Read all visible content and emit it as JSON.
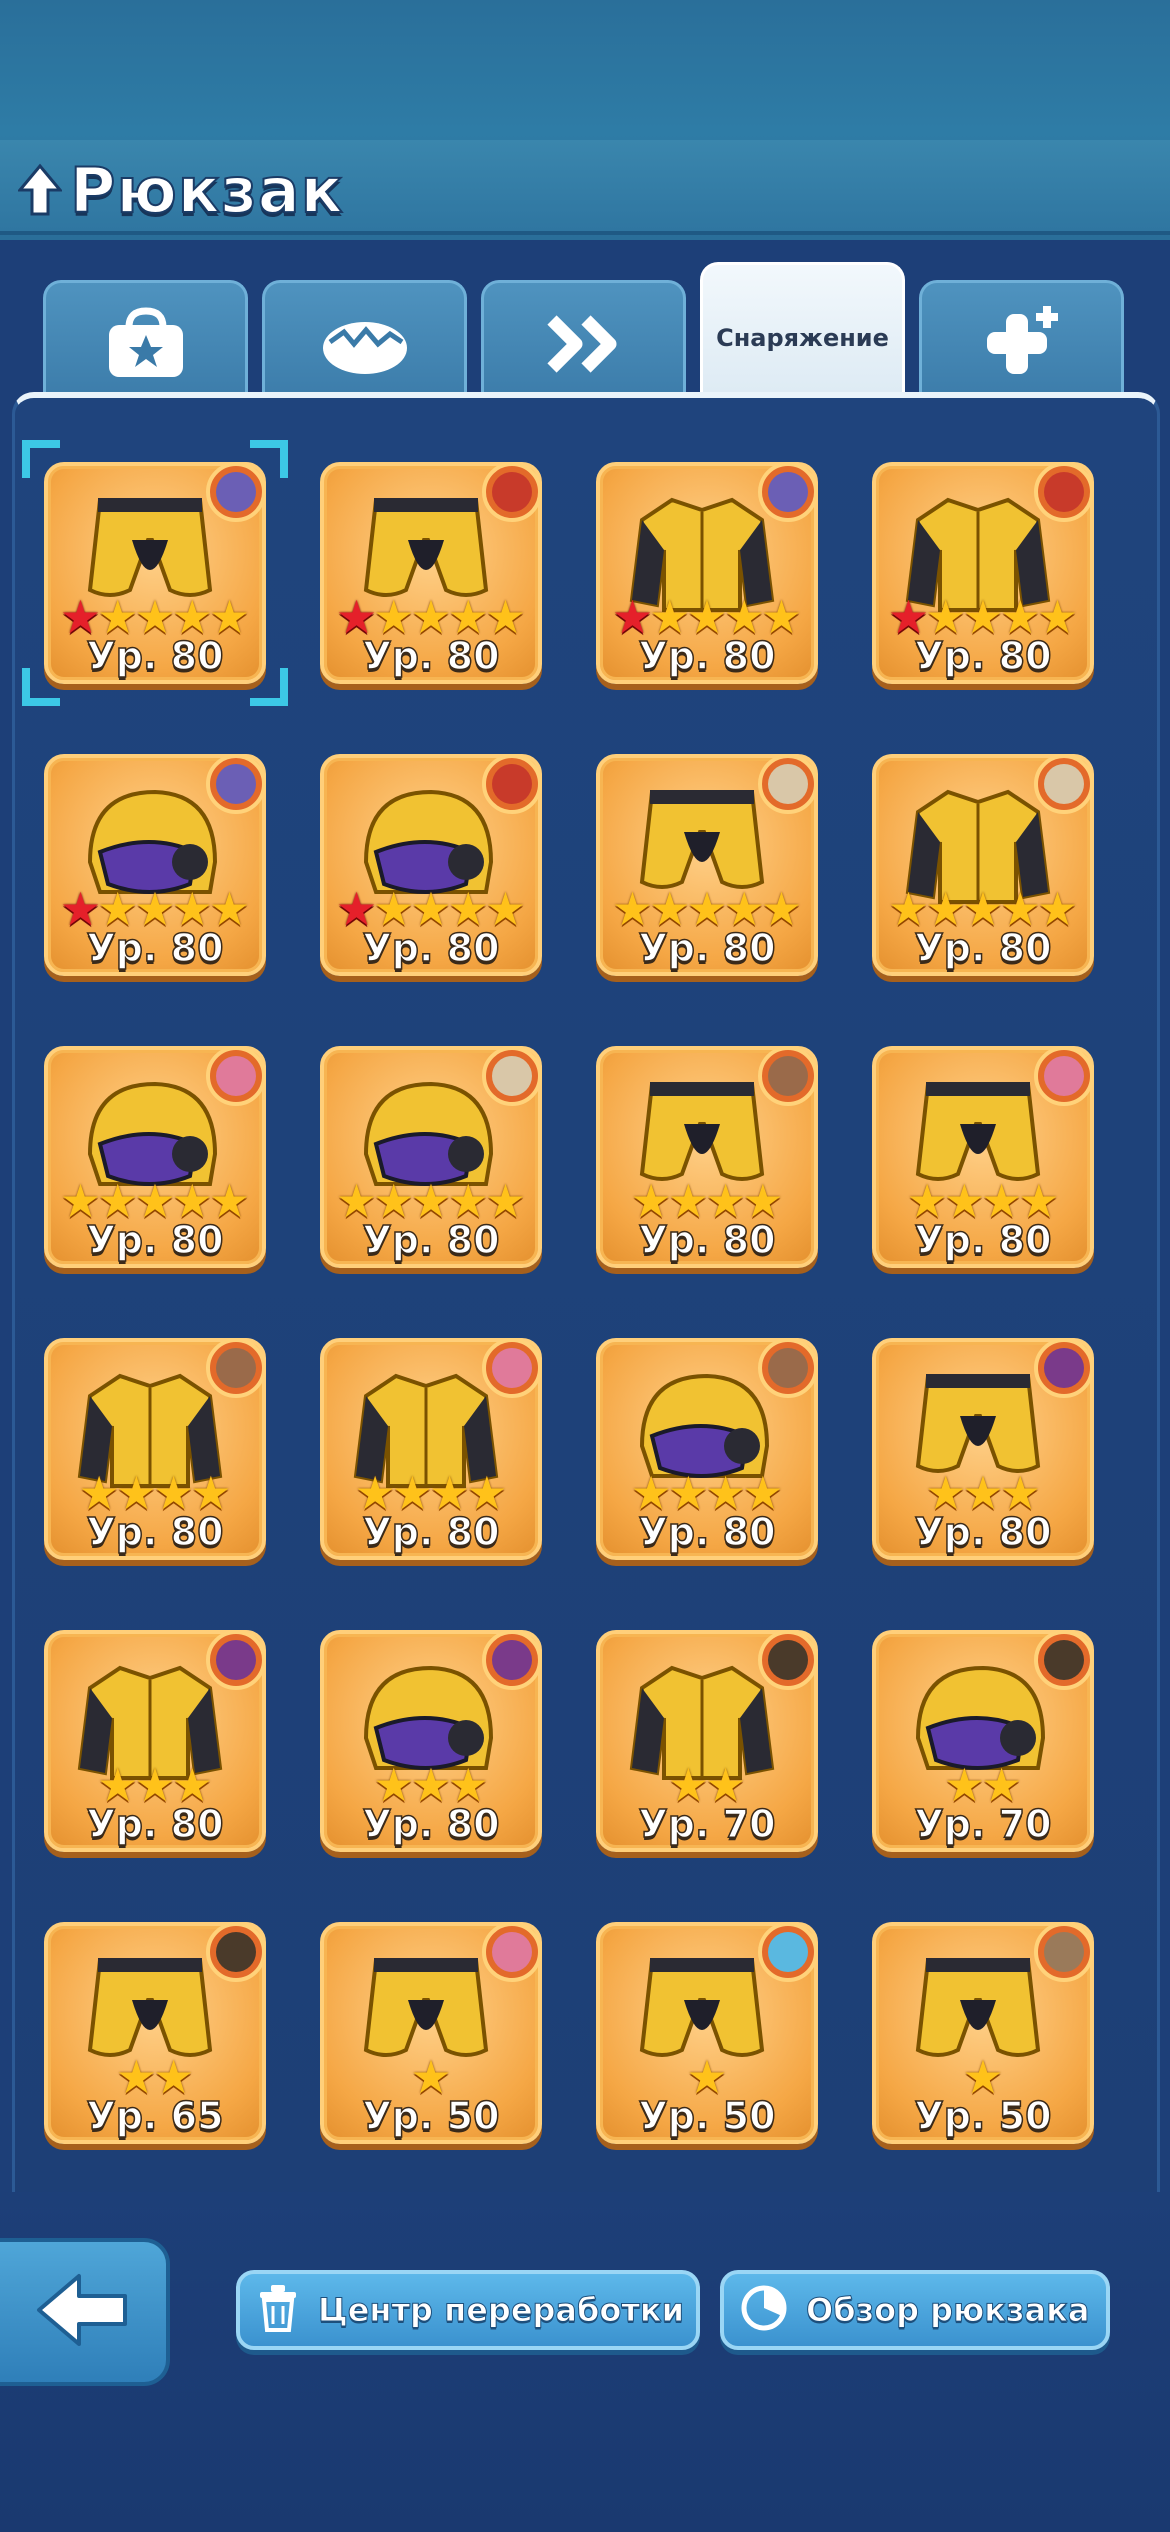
{
  "header": {
    "title": "Рюкзак"
  },
  "tabs": [
    {
      "icon": "bag-icon",
      "label": ""
    },
    {
      "icon": "egg-icon",
      "label": ""
    },
    {
      "icon": "fast-forward-icon",
      "label": ""
    },
    {
      "icon": "",
      "label": "Снаряжение",
      "active": true
    },
    {
      "icon": "puzzle-plus-icon",
      "label": ""
    }
  ],
  "items": [
    {
      "type": "pants",
      "stars": 5,
      "red_stars": 1,
      "level": "Ур. 80",
      "avatar": "#6b5fb5",
      "selected": true
    },
    {
      "type": "pants",
      "stars": 5,
      "red_stars": 1,
      "level": "Ур. 80",
      "avatar": "#c83a2a"
    },
    {
      "type": "jacket",
      "stars": 5,
      "red_stars": 1,
      "level": "Ур. 80",
      "avatar": "#6b5fb5"
    },
    {
      "type": "jacket",
      "stars": 5,
      "red_stars": 1,
      "level": "Ур. 80",
      "avatar": "#c83a2a"
    },
    {
      "type": "helmet",
      "stars": 5,
      "red_stars": 1,
      "level": "Ур. 80",
      "avatar": "#6b5fb5"
    },
    {
      "type": "helmet",
      "stars": 5,
      "red_stars": 1,
      "level": "Ур. 80",
      "avatar": "#c83a2a"
    },
    {
      "type": "pants",
      "stars": 5,
      "red_stars": 0,
      "level": "Ур. 80",
      "avatar": "#d9c7a8"
    },
    {
      "type": "jacket",
      "stars": 5,
      "red_stars": 0,
      "level": "Ур. 80",
      "avatar": "#d9c7a8"
    },
    {
      "type": "helmet",
      "stars": 5,
      "red_stars": 0,
      "level": "Ур. 80",
      "avatar": "#e07a9a"
    },
    {
      "type": "helmet",
      "stars": 5,
      "red_stars": 0,
      "level": "Ур. 80",
      "avatar": "#d9c7a8"
    },
    {
      "type": "pants",
      "stars": 4,
      "red_stars": 0,
      "level": "Ур. 80",
      "avatar": "#9a6a4a"
    },
    {
      "type": "pants",
      "stars": 4,
      "red_stars": 0,
      "level": "Ур. 80",
      "avatar": "#e07a9a"
    },
    {
      "type": "jacket",
      "stars": 4,
      "red_stars": 0,
      "level": "Ур. 80",
      "avatar": "#9a6a4a"
    },
    {
      "type": "jacket",
      "stars": 4,
      "red_stars": 0,
      "level": "Ур. 80",
      "avatar": "#e07a9a"
    },
    {
      "type": "helmet",
      "stars": 4,
      "red_stars": 0,
      "level": "Ур. 80",
      "avatar": "#9a6a4a"
    },
    {
      "type": "pants",
      "stars": 3,
      "red_stars": 0,
      "level": "Ур. 80",
      "avatar": "#7a3a8a"
    },
    {
      "type": "jacket",
      "stars": 3,
      "red_stars": 0,
      "level": "Ур. 80",
      "avatar": "#7a3a8a"
    },
    {
      "type": "helmet",
      "stars": 3,
      "red_stars": 0,
      "level": "Ур. 80",
      "avatar": "#7a3a8a"
    },
    {
      "type": "jacket",
      "stars": 2,
      "red_stars": 0,
      "level": "Ур. 70",
      "avatar": "#4a3a2a"
    },
    {
      "type": "helmet",
      "stars": 2,
      "red_stars": 0,
      "level": "Ур. 70",
      "avatar": "#4a3a2a"
    },
    {
      "type": "pants",
      "stars": 2,
      "red_stars": 0,
      "level": "Ур. 65",
      "avatar": "#4a3a2a"
    },
    {
      "type": "pants",
      "stars": 1,
      "red_stars": 0,
      "level": "Ур. 50",
      "avatar": "#e07a9a"
    },
    {
      "type": "pants",
      "stars": 1,
      "red_stars": 0,
      "level": "Ур. 50",
      "avatar": "#5ab8e0"
    },
    {
      "type": "pants",
      "stars": 1,
      "red_stars": 0,
      "level": "Ур. 50",
      "avatar": "#9a7a5a"
    }
  ],
  "bottom": {
    "back_icon": "back-arrow-icon",
    "recycle_label": "Центр переработки",
    "recycle_icon": "trash-icon",
    "overview_label": "Обзор рюкзака",
    "overview_icon": "pie-chart-icon"
  },
  "colors": {
    "background": "#1d3f78",
    "item_bg": "#f5a745",
    "star": "#ffc21a",
    "red_star": "#e5202a",
    "selection": "#3cc8e6",
    "button": "#3b92cf"
  }
}
